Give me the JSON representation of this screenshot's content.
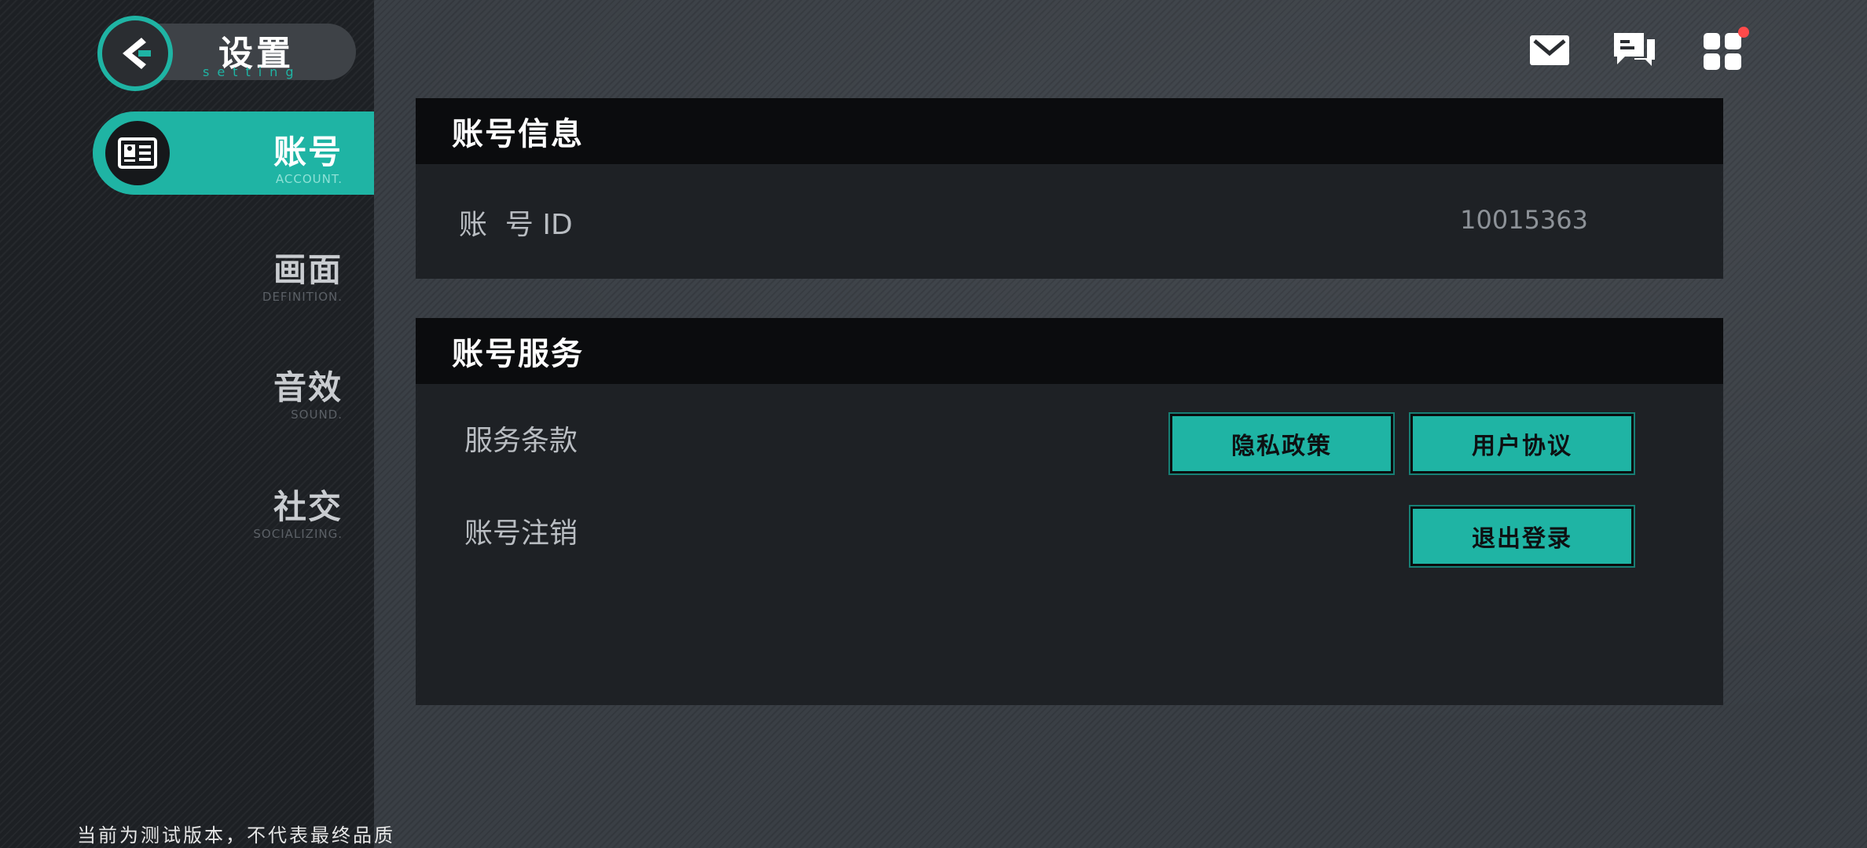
{
  "header": {
    "title": "设置",
    "subtitle": "setting"
  },
  "sidebar": {
    "items": [
      {
        "label": "账号",
        "sub": "ACCOUNT.",
        "active": true
      },
      {
        "label": "画面",
        "sub": "DEFINITION."
      },
      {
        "label": "音效",
        "sub": "SOUND."
      },
      {
        "label": "社交",
        "sub": "SOCIALIZING."
      }
    ]
  },
  "top_icons": [
    "mail-icon",
    "chat-icon",
    "apps-icon"
  ],
  "account_info": {
    "heading": "账号信息",
    "id_label": "账  号 ID",
    "id_value": "10015363"
  },
  "account_service": {
    "heading": "账号服务",
    "terms_label": "服务条款",
    "privacy_button": "隐私政策",
    "user_agreement_button": "用户协议",
    "deregister_label": "账号注销",
    "logout_button": "退出登录"
  },
  "watermark": "当前为测试版本，不代表最终品质",
  "colors": {
    "accent": "#1fb4a4",
    "badge": "#ff4a4a"
  }
}
